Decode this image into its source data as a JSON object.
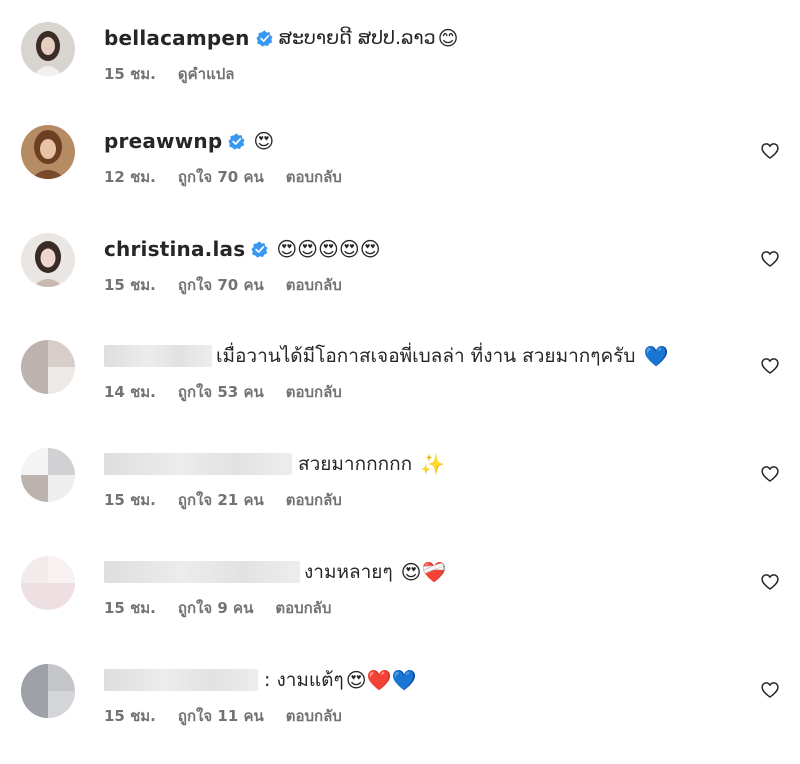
{
  "comments": [
    {
      "username": "bellacampen",
      "verified": true,
      "text": "ສະບາຍດີ ສປປ.ລາວ",
      "emoji": "😊",
      "time": "15 ชม.",
      "likes": "",
      "action": "ดูคำแปล",
      "show_heart": false
    },
    {
      "username": "preawwnp",
      "verified": true,
      "text": "",
      "emoji": "😍",
      "time": "12 ชม.",
      "likes": "ถูกใจ 70 คน",
      "action": "ตอบกลับ",
      "show_heart": true
    },
    {
      "username": "christina.las",
      "verified": true,
      "text": "",
      "emoji": "😍😍😍😍😍",
      "time": "15 ชม.",
      "likes": "ถูกใจ 70 คน",
      "action": "ตอบกลับ",
      "show_heart": true
    },
    {
      "username": "",
      "verified": false,
      "text": "เมื่อวานได้มีโอกาสเจอพี่เบลล่า ที่งาน สวยมากๆครับ",
      "emoji": "💙",
      "time": "14 ชม.",
      "likes": "ถูกใจ 53 คน",
      "action": "ตอบกลับ",
      "show_heart": true
    },
    {
      "username": "",
      "verified": false,
      "text": "สวยมากกกกก",
      "emoji": "✨",
      "time": "15 ชม.",
      "likes": "ถูกใจ 21 คน",
      "action": "ตอบกลับ",
      "show_heart": true
    },
    {
      "username": "",
      "verified": false,
      "text": "งามหลายๆ",
      "emoji": "😍❤️‍🩹",
      "time": "15 ชม.",
      "likes": "ถูกใจ 9 คน",
      "action": "ตอบกลับ",
      "show_heart": true
    },
    {
      "username": "",
      "verified": false,
      "text": ": งามแต้ๆ",
      "emoji": "😍❤️💙",
      "time": "15 ชม.",
      "likes": "ถูกใจ 11 คน",
      "action": "ตอบกลับ",
      "show_heart": true
    }
  ],
  "colors": {
    "text": "#262626",
    "meta": "#737373",
    "verified": "#3897f0"
  }
}
